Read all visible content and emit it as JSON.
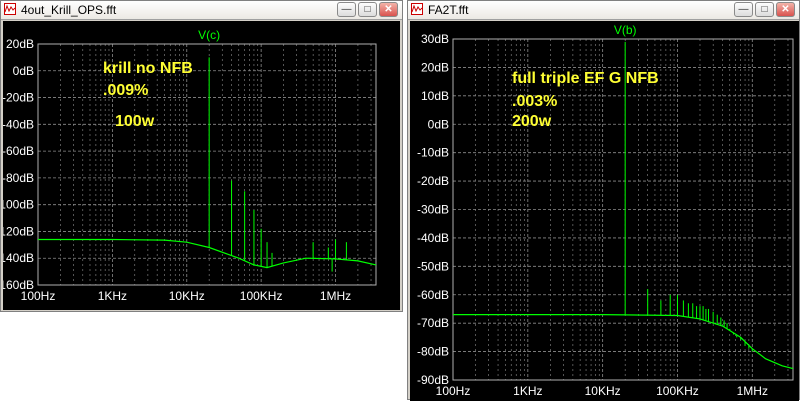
{
  "colors": {
    "trace": "#00ff00",
    "annotation": "#ffff33",
    "grid": "#8c8c8c",
    "background": "#000000",
    "label": "#ffffff"
  },
  "windows": [
    {
      "title": "4out_Krill_OPS.fft",
      "buttons": {
        "minimize": "—",
        "maximize": "□",
        "close": "✕"
      },
      "icon": "waveform-icon",
      "trace_label": "V(c)",
      "annotations": [
        "krill no NFB",
        ".009%",
        "100w"
      ],
      "chart_data": {
        "type": "line",
        "title": "",
        "series": [
          {
            "name": "V(c)"
          }
        ],
        "x_scale": "log",
        "x_ticks": [
          "100Hz",
          "1KHz",
          "10KHz",
          "100KHz",
          "1MHz"
        ],
        "x_tick_values": [
          100,
          1000,
          10000,
          100000,
          1000000
        ],
        "xlim": [
          100,
          3500000
        ],
        "y_ticks": [
          "20dB",
          "0dB",
          "-20dB",
          "-40dB",
          "-60dB",
          "-80dB",
          "-100dB",
          "-120dB",
          "-140dB",
          "-160dB"
        ],
        "y_tick_values": [
          20,
          0,
          -20,
          -40,
          -60,
          -80,
          -100,
          -120,
          -140,
          -160
        ],
        "ylim": [
          -160,
          20
        ],
        "grid": true,
        "noise_floor": [
          [
            100,
            -126
          ],
          [
            1000,
            -126
          ],
          [
            5000,
            -126.5
          ],
          [
            10000,
            -128
          ],
          [
            20000,
            -132
          ],
          [
            50000,
            -140
          ],
          [
            80000,
            -145
          ],
          [
            120000,
            -147
          ],
          [
            200000,
            -143.5
          ],
          [
            400000,
            -140
          ],
          [
            1000000,
            -140.5
          ],
          [
            2000000,
            -142
          ],
          [
            3500000,
            -145
          ]
        ],
        "harmonics": [
          [
            20000,
            10
          ],
          [
            40000,
            -82
          ],
          [
            60000,
            -90
          ],
          [
            80000,
            -104
          ],
          [
            100000,
            -118
          ],
          [
            120000,
            -128
          ],
          [
            140000,
            -136
          ],
          [
            500000,
            -128
          ],
          [
            800000,
            -132
          ],
          [
            900000,
            -150
          ],
          [
            1000000,
            -126
          ],
          [
            1400000,
            -128
          ]
        ]
      }
    },
    {
      "title": "FA2T.fft",
      "buttons": {
        "minimize": "—",
        "maximize": "□",
        "close": "✕"
      },
      "icon": "waveform-icon",
      "trace_label": "V(b)",
      "annotations": [
        "full triple EF G NFB",
        ".003%",
        "200w"
      ],
      "chart_data": {
        "type": "line",
        "title": "",
        "series": [
          {
            "name": "V(b)"
          }
        ],
        "x_scale": "log",
        "x_ticks": [
          "100Hz",
          "1KHz",
          "10KHz",
          "100KHz",
          "1MHz"
        ],
        "x_tick_values": [
          100,
          1000,
          10000,
          100000,
          1000000
        ],
        "xlim": [
          100,
          3500000
        ],
        "y_ticks": [
          "30dB",
          "20dB",
          "10dB",
          "0dB",
          "-10dB",
          "-20dB",
          "-30dB",
          "-40dB",
          "-50dB",
          "-60dB",
          "-70dB",
          "-80dB",
          "-90dB"
        ],
        "y_tick_values": [
          30,
          20,
          10,
          0,
          -10,
          -20,
          -30,
          -40,
          -50,
          -60,
          -70,
          -80,
          -90
        ],
        "ylim": [
          -90,
          30
        ],
        "grid": true,
        "noise_floor": [
          [
            100,
            -67
          ],
          [
            10000,
            -67
          ],
          [
            100000,
            -67.3
          ],
          [
            200000,
            -68.5
          ],
          [
            400000,
            -71
          ],
          [
            700000,
            -75
          ],
          [
            1000000,
            -79
          ],
          [
            1500000,
            -82.5
          ],
          [
            2500000,
            -85
          ],
          [
            3500000,
            -86
          ]
        ],
        "harmonics": [
          [
            20000,
            29
          ],
          [
            40000,
            -58
          ],
          [
            60000,
            -62
          ],
          [
            80000,
            -60
          ],
          [
            100000,
            -60
          ],
          [
            120000,
            -62
          ],
          [
            140000,
            -63
          ],
          [
            160000,
            -63
          ],
          [
            180000,
            -64
          ],
          [
            200000,
            -64
          ],
          [
            220000,
            -64
          ],
          [
            240000,
            -65
          ],
          [
            260000,
            -65
          ],
          [
            300000,
            -66
          ],
          [
            340000,
            -67
          ],
          [
            380000,
            -68
          ],
          [
            420000,
            -69
          ],
          [
            460000,
            -70
          ],
          [
            500000,
            -72
          ],
          [
            560000,
            -74
          ],
          [
            620000,
            -75
          ],
          [
            700000,
            -76
          ],
          [
            800000,
            -78
          ],
          [
            900000,
            -79
          ],
          [
            1000000,
            -80
          ]
        ]
      }
    }
  ]
}
